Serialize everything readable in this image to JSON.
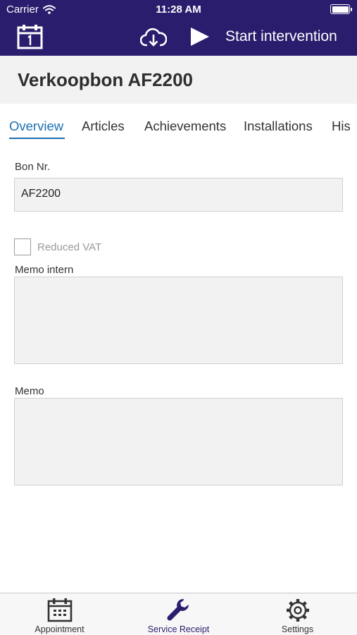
{
  "status_bar": {
    "carrier": "Carrier",
    "time": "11:28 AM"
  },
  "toolbar": {
    "icons": [
      "calendar-icon",
      "cloud-download-icon",
      "play-icon"
    ],
    "start_label": "Start intervention"
  },
  "header": {
    "title": "Verkoopbon AF2200"
  },
  "tabs": [
    {
      "label": "Overview",
      "active": true
    },
    {
      "label": "Articles",
      "active": false
    },
    {
      "label": "Achievements",
      "active": false
    },
    {
      "label": "Installations",
      "active": false
    },
    {
      "label": "His",
      "active": false
    }
  ],
  "form": {
    "bon_nr_label": "Bon Nr.",
    "bon_nr_value": "AF2200",
    "reduced_vat_label": "Reduced VAT",
    "reduced_vat_checked": false,
    "memo_intern_label": "Memo intern",
    "memo_intern_value": "",
    "memo_label": "Memo",
    "memo_value": ""
  },
  "tab_bar": [
    {
      "label": "Appointment",
      "icon": "calendar-icon",
      "active": false
    },
    {
      "label": "Service Receipt",
      "icon": "wrench-icon",
      "active": true
    },
    {
      "label": "Settings",
      "icon": "gear-icon",
      "active": false
    }
  ],
  "colors": {
    "header_bar": "#2b1d6e",
    "accent_tab": "#1b6fb3",
    "field_background": "#f2f2f2"
  }
}
